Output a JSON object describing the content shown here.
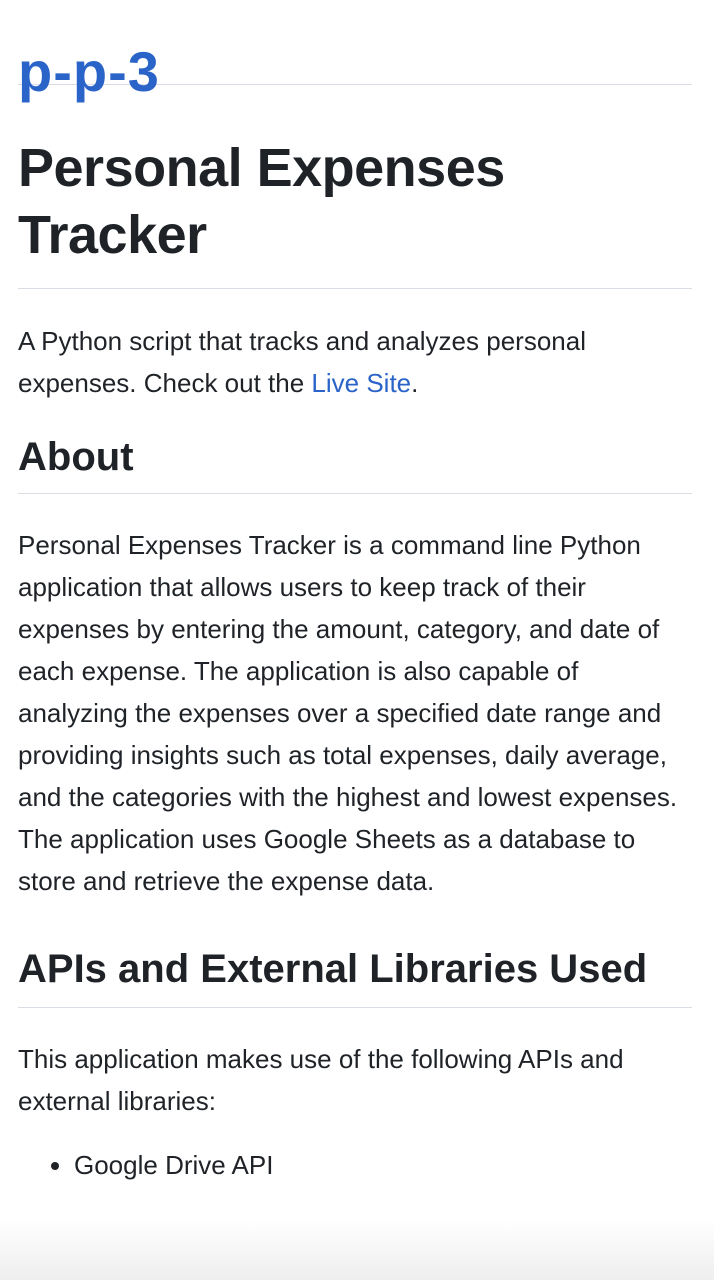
{
  "site": {
    "title": "p-p-3"
  },
  "readme": {
    "heading": "Personal Expenses Tracker",
    "intro_text": "A Python script that tracks and analyzes personal expenses. Check out the ",
    "intro_link": "Live Site",
    "intro_end": ".",
    "about": {
      "heading": "About",
      "text": "Personal Expenses Tracker is a command line Python application that allows users to keep track of their expenses by entering the amount, category, and date of each expense. The application is also capable of analyzing the expenses over a specified date range and providing insights such as total expenses, daily average, and the categories with the highest and lowest expenses. The application uses Google Sheets as a database to store and retrieve the expense data."
    },
    "apis": {
      "heading": "APIs and External Libraries Used",
      "text": "This application makes use of the following APIs and external libraries:",
      "items": [
        "Google Drive API"
      ]
    }
  }
}
